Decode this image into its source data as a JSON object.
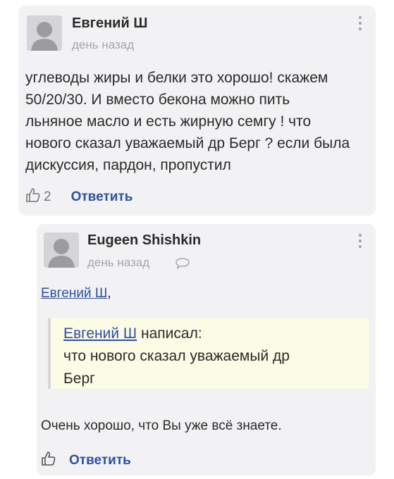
{
  "comment1": {
    "author": "Евгений Ш",
    "time": "день назад",
    "lines": [
      "углеводы жиры и белки это хорошо! скажем",
      "50/20/30. И вместо бекона можно пить",
      "льняное масло и есть жирную семгу !  что",
      "нового сказал уважаемый др Берг ? если была",
      "дискуссия, пардон, пропустил"
    ],
    "likes": "2",
    "reply_label": "Ответить",
    "icons": {
      "avatar": "user-avatar-placeholder",
      "menu": "kebab-menu-icon",
      "like": "thumbs-up-icon"
    }
  },
  "comment2": {
    "author": "Eugeen Shishkin",
    "time": "день назад",
    "mention": "Евгений Ш",
    "mention_suffix": ",",
    "quote": {
      "author": "Евгений Ш",
      "verb": "написал:",
      "lines": [
        "что нового сказал уважаемый др",
        "Берг"
      ]
    },
    "text": "Очень хорошо, что Вы уже всё знаете.",
    "reply_label": "Ответить",
    "icons": {
      "avatar": "user-avatar-placeholder",
      "menu": "kebab-menu-icon",
      "comment": "comment-bubble-icon",
      "like": "thumbs-up-icon"
    }
  },
  "colors": {
    "card_bg": "#f2f2f4",
    "link": "#2f4fa0",
    "quote_bg": "#fbfbe6"
  }
}
